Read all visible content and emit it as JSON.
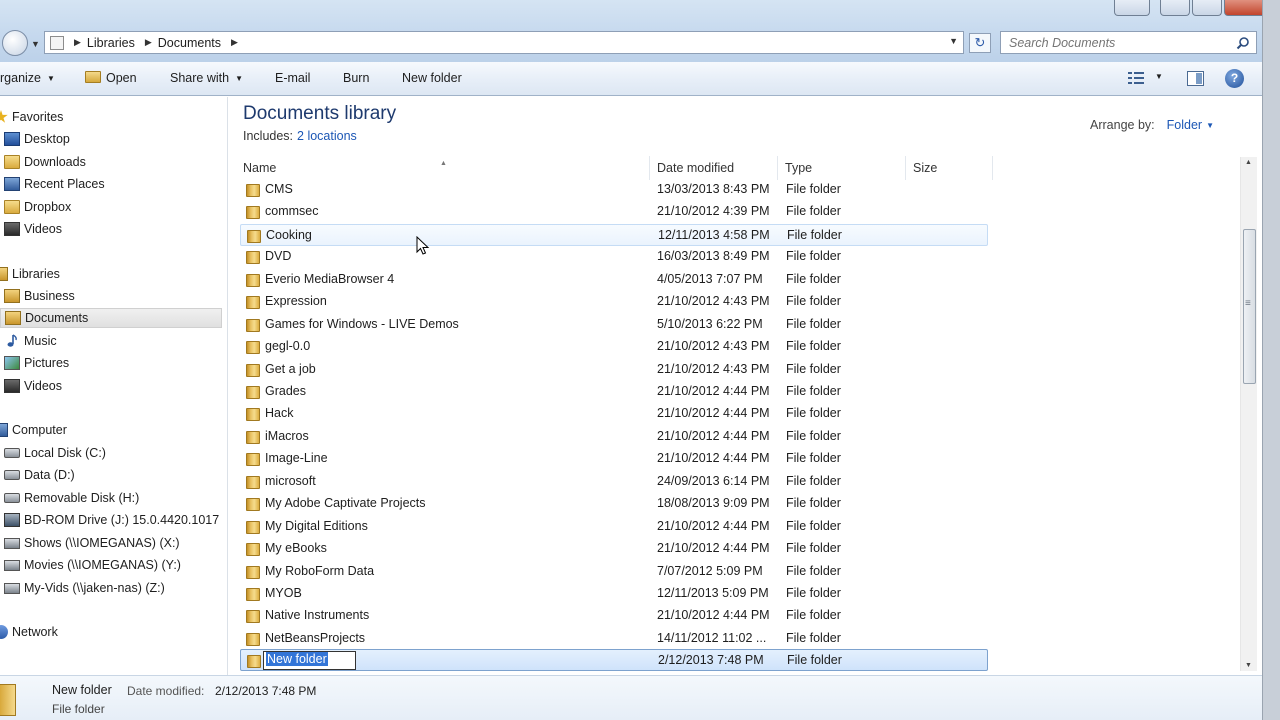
{
  "address": {
    "breadcrumbs": [
      "Libraries",
      "Documents"
    ],
    "search_placeholder": "Search Documents"
  },
  "toolbar": {
    "organize": "rganize",
    "open": "Open",
    "share_with": "Share with",
    "email": "E-mail",
    "burn": "Burn",
    "new_folder": "New folder"
  },
  "nav": {
    "favorites": "Favorites",
    "desktop": "Desktop",
    "downloads": "Downloads",
    "recent_places": "Recent Places",
    "dropbox": "Dropbox",
    "videos_fav": "Videos",
    "libraries": "Libraries",
    "business": "Business",
    "documents": "Documents",
    "music": "Music",
    "pictures": "Pictures",
    "videos_lib": "Videos",
    "computer": "Computer",
    "local_disk": "Local Disk (C:)",
    "data_d": "Data (D:)",
    "removable": "Removable Disk (H:)",
    "bd_rom": "BD-ROM Drive (J:) 15.0.4420.1017",
    "shows": "Shows (\\\\IOMEGANAS) (X:)",
    "movies": "Movies (\\\\IOMEGANAS) (Y:)",
    "myvids": "My-Vids (\\\\jaken-nas) (Z:)",
    "network": "Network"
  },
  "library": {
    "title": "Documents library",
    "includes_label": "Includes:",
    "includes_link": "2 locations",
    "arrange_label": "Arrange by:",
    "arrange_value": "Folder"
  },
  "columns": {
    "name": "Name",
    "date": "Date modified",
    "type": "Type",
    "size": "Size"
  },
  "files": [
    {
      "name": "CMS",
      "date": "13/03/2013 8:43 PM",
      "type": "File folder"
    },
    {
      "name": "commsec",
      "date": "21/10/2012 4:39 PM",
      "type": "File folder"
    },
    {
      "name": "Cooking",
      "date": "12/11/2013 4:58 PM",
      "type": "File folder"
    },
    {
      "name": "DVD",
      "date": "16/03/2013 8:49 PM",
      "type": "File folder"
    },
    {
      "name": "Everio MediaBrowser 4",
      "date": "4/05/2013 7:07 PM",
      "type": "File folder"
    },
    {
      "name": "Expression",
      "date": "21/10/2012 4:43 PM",
      "type": "File folder"
    },
    {
      "name": "Games for Windows - LIVE Demos",
      "date": "5/10/2013 6:22 PM",
      "type": "File folder"
    },
    {
      "name": "gegl-0.0",
      "date": "21/10/2012 4:43 PM",
      "type": "File folder"
    },
    {
      "name": "Get a job",
      "date": "21/10/2012 4:43 PM",
      "type": "File folder"
    },
    {
      "name": "Grades",
      "date": "21/10/2012 4:44 PM",
      "type": "File folder"
    },
    {
      "name": "Hack",
      "date": "21/10/2012 4:44 PM",
      "type": "File folder"
    },
    {
      "name": "iMacros",
      "date": "21/10/2012 4:44 PM",
      "type": "File folder"
    },
    {
      "name": "Image-Line",
      "date": "21/10/2012 4:44 PM",
      "type": "File folder"
    },
    {
      "name": "microsoft",
      "date": "24/09/2013 6:14 PM",
      "type": "File folder"
    },
    {
      "name": "My Adobe Captivate Projects",
      "date": "18/08/2013 9:09 PM",
      "type": "File folder"
    },
    {
      "name": "My Digital Editions",
      "date": "21/10/2012 4:44 PM",
      "type": "File folder"
    },
    {
      "name": "My eBooks",
      "date": "21/10/2012 4:44 PM",
      "type": "File folder"
    },
    {
      "name": "My RoboForm Data",
      "date": "7/07/2012 5:09 PM",
      "type": "File folder"
    },
    {
      "name": "MYOB",
      "date": "12/11/2013 5:09 PM",
      "type": "File folder"
    },
    {
      "name": "Native Instruments",
      "date": "21/10/2012 4:44 PM",
      "type": "File folder"
    },
    {
      "name": "NetBeansProjects",
      "date": "14/11/2012 11:02 ...",
      "type": "File folder"
    },
    {
      "name": "New folder",
      "date": "2/12/2013 7:48 PM",
      "type": "File folder"
    }
  ],
  "details": {
    "name": "New folder",
    "date_label": "Date modified:",
    "date_value": "2/12/2013 7:48 PM",
    "type": "File folder"
  }
}
